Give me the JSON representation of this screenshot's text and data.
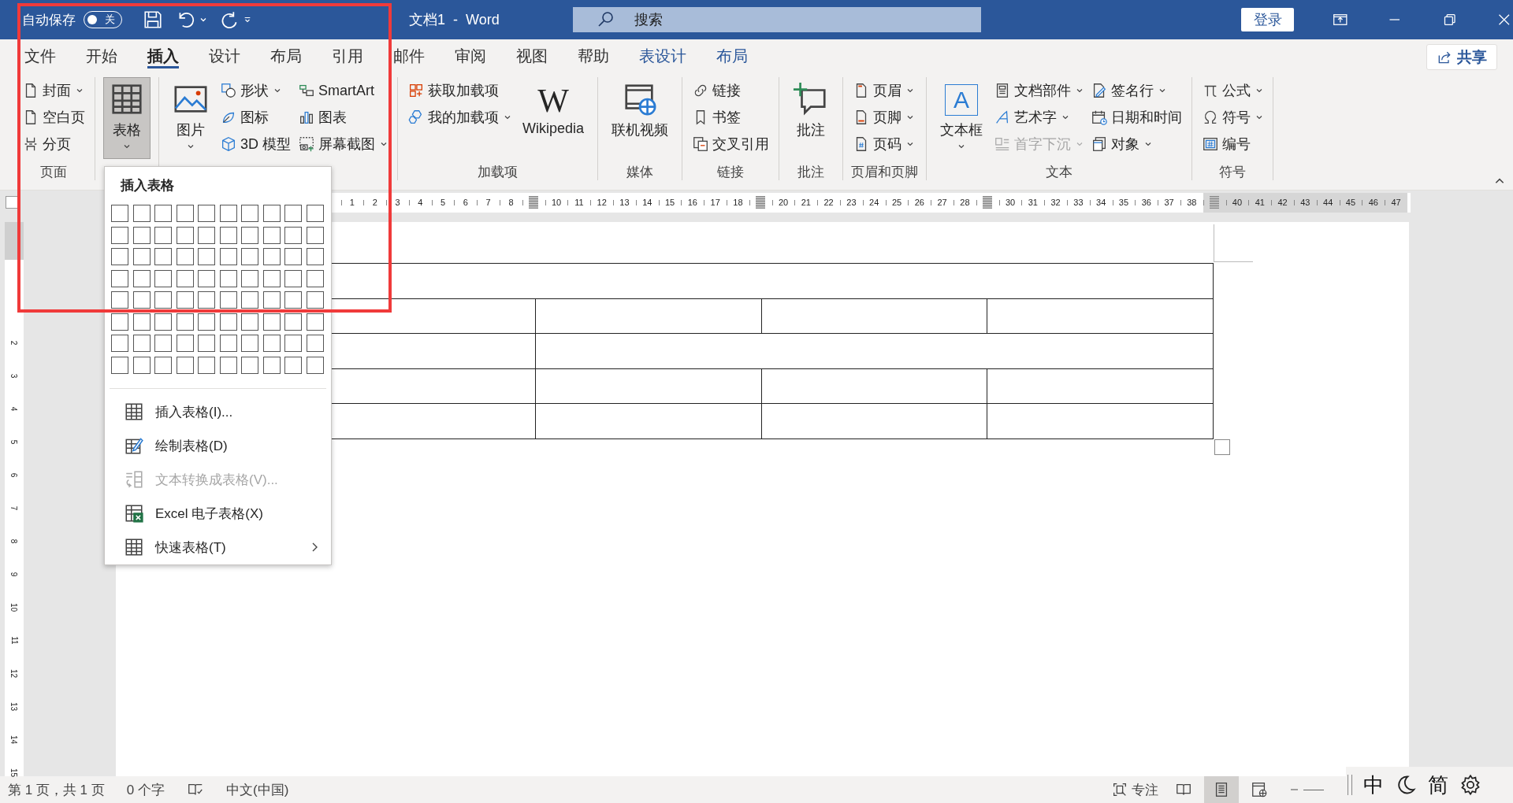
{
  "title_bar": {
    "autosave_label": "自动保存",
    "autosave_toggle": {
      "on": false,
      "label": "关"
    },
    "title": "文档1  -  Word",
    "search": {
      "placeholder": "搜索"
    },
    "sign_in": "登录"
  },
  "tabs": [
    {
      "label": "文件",
      "selected": false,
      "kind": "standard"
    },
    {
      "label": "开始",
      "selected": false,
      "kind": "standard"
    },
    {
      "label": "插入",
      "selected": true,
      "kind": "standard"
    },
    {
      "label": "设计",
      "selected": false,
      "kind": "standard"
    },
    {
      "label": "布局",
      "selected": false,
      "kind": "standard"
    },
    {
      "label": "引用",
      "selected": false,
      "kind": "standard"
    },
    {
      "label": "邮件",
      "selected": false,
      "kind": "standard"
    },
    {
      "label": "审阅",
      "selected": false,
      "kind": "standard"
    },
    {
      "label": "视图",
      "selected": false,
      "kind": "standard"
    },
    {
      "label": "帮助",
      "selected": false,
      "kind": "standard"
    },
    {
      "label": "表设计",
      "selected": false,
      "kind": "contextual"
    },
    {
      "label": "布局",
      "selected": false,
      "kind": "contextual"
    }
  ],
  "share_button": "共享",
  "ribbon": {
    "groups": [
      {
        "label": "页面",
        "columns": [
          {
            "kind": "stack",
            "items": [
              {
                "label": "封面",
                "dropdown": true
              },
              {
                "label": "空白页",
                "dropdown": false
              },
              {
                "label": "分页",
                "dropdown": false
              }
            ]
          }
        ]
      },
      {
        "columns": [
          {
            "kind": "large",
            "items": [
              {
                "label": "表格",
                "dropdown": true,
                "pressed": true
              }
            ]
          }
        ]
      },
      {
        "columns": [
          {
            "kind": "large",
            "items": [
              {
                "label": "图片",
                "dropdown": true,
                "pressed": false
              }
            ]
          },
          {
            "kind": "stack",
            "items": [
              {
                "label": "形状",
                "dropdown": true
              },
              {
                "label": "图标",
                "dropdown": false
              },
              {
                "label": "3D 模型",
                "dropdown": false
              }
            ]
          },
          {
            "kind": "stack",
            "items": [
              {
                "label": "SmartArt",
                "dropdown": false
              },
              {
                "label": "图表",
                "dropdown": false
              },
              {
                "label": "屏幕截图",
                "dropdown": true
              }
            ]
          }
        ]
      },
      {
        "label": "加载项",
        "columns": [
          {
            "kind": "stack",
            "items": [
              {
                "label": "获取加载项",
                "dropdown": false
              },
              {
                "label": "我的加载项",
                "dropdown": true
              }
            ]
          },
          {
            "kind": "large",
            "items": [
              {
                "label": "Wikipedia",
                "glyph": "W",
                "dropdown": false,
                "pressed": false
              }
            ]
          }
        ]
      },
      {
        "label": "媒体",
        "columns": [
          {
            "kind": "large",
            "items": [
              {
                "label": "联机视频",
                "dropdown": false,
                "pressed": false
              }
            ]
          }
        ]
      },
      {
        "label": "链接",
        "columns": [
          {
            "kind": "stack",
            "items": [
              {
                "label": "链接",
                "dropdown": false
              },
              {
                "label": "书签",
                "dropdown": false
              },
              {
                "label": "交叉引用",
                "dropdown": false
              }
            ]
          }
        ]
      },
      {
        "label": "批注",
        "columns": [
          {
            "kind": "large",
            "items": [
              {
                "label": "批注",
                "dropdown": false,
                "pressed": false
              }
            ]
          }
        ]
      },
      {
        "label": "页眉和页脚",
        "columns": [
          {
            "kind": "stack",
            "items": [
              {
                "label": "页眉",
                "dropdown": true
              },
              {
                "label": "页脚",
                "dropdown": true
              },
              {
                "label": "页码",
                "dropdown": true
              }
            ]
          }
        ]
      },
      {
        "label": "文本",
        "columns": [
          {
            "kind": "large",
            "items": [
              {
                "label": "文本框",
                "glyph": "A",
                "dropdown": true,
                "pressed": false
              }
            ]
          },
          {
            "kind": "stack",
            "items": [
              {
                "label": "文档部件",
                "dropdown": true,
                "disabled": false
              },
              {
                "label": "艺术字",
                "dropdown": true,
                "disabled": false
              },
              {
                "label": "首字下沉",
                "dropdown": true,
                "disabled": true
              }
            ]
          },
          {
            "kind": "stack",
            "items": [
              {
                "label": "签名行",
                "dropdown": true
              },
              {
                "label": "日期和时间",
                "dropdown": false
              },
              {
                "label": "对象",
                "dropdown": true
              }
            ]
          }
        ]
      },
      {
        "label": "符号",
        "columns": [
          {
            "kind": "stack",
            "items": [
              {
                "label": "公式",
                "dropdown": true
              },
              {
                "label": "符号",
                "dropdown": true
              },
              {
                "label": "编号",
                "dropdown": false
              }
            ]
          }
        ]
      }
    ]
  },
  "horizontal_ruler": [
    {
      "kind": "number",
      "label": "1"
    },
    {
      "kind": "number",
      "label": "2"
    },
    {
      "kind": "number",
      "label": "3"
    },
    {
      "kind": "number",
      "label": "4"
    },
    {
      "kind": "number",
      "label": "5"
    },
    {
      "kind": "number",
      "label": "6"
    },
    {
      "kind": "number",
      "label": "7"
    },
    {
      "kind": "number",
      "label": "8"
    },
    {
      "kind": "marker"
    },
    {
      "kind": "number",
      "label": "10"
    },
    {
      "kind": "number",
      "label": "11"
    },
    {
      "kind": "number",
      "label": "12"
    },
    {
      "kind": "number",
      "label": "13"
    },
    {
      "kind": "number",
      "label": "14"
    },
    {
      "kind": "number",
      "label": "15"
    },
    {
      "kind": "number",
      "label": "16"
    },
    {
      "kind": "number",
      "label": "17"
    },
    {
      "kind": "number",
      "label": "18"
    },
    {
      "kind": "marker"
    },
    {
      "kind": "number",
      "label": "20"
    },
    {
      "kind": "number",
      "label": "21"
    },
    {
      "kind": "number",
      "label": "22"
    },
    {
      "kind": "number",
      "label": "23"
    },
    {
      "kind": "number",
      "label": "24"
    },
    {
      "kind": "number",
      "label": "25"
    },
    {
      "kind": "number",
      "label": "26"
    },
    {
      "kind": "number",
      "label": "27"
    },
    {
      "kind": "number",
      "label": "28"
    },
    {
      "kind": "marker"
    },
    {
      "kind": "number",
      "label": "30"
    },
    {
      "kind": "number",
      "label": "31"
    },
    {
      "kind": "number",
      "label": "32"
    },
    {
      "kind": "number",
      "label": "33"
    },
    {
      "kind": "number",
      "label": "34"
    },
    {
      "kind": "number",
      "label": "35"
    },
    {
      "kind": "number",
      "label": "36"
    },
    {
      "kind": "number",
      "label": "37"
    },
    {
      "kind": "number",
      "label": "38"
    },
    {
      "kind": "marker"
    },
    {
      "kind": "number",
      "label": "40"
    },
    {
      "kind": "number",
      "label": "41"
    },
    {
      "kind": "number",
      "label": "42"
    },
    {
      "kind": "number",
      "label": "43"
    },
    {
      "kind": "number",
      "label": "44"
    },
    {
      "kind": "number",
      "label": "45"
    },
    {
      "kind": "number",
      "label": "46"
    },
    {
      "kind": "number",
      "label": "47"
    }
  ],
  "vertical_ruler": [
    "2",
    "3",
    "4",
    "5",
    "6",
    "7",
    "8",
    "9",
    "10",
    "11",
    "12",
    "13",
    "14",
    "15"
  ],
  "insert_table_menu": {
    "title": "插入表格",
    "items": [
      {
        "label": "插入表格(I)...",
        "kind": "command",
        "disabled": false
      },
      {
        "label": "绘制表格(D)",
        "kind": "command",
        "disabled": false
      },
      {
        "label": "文本转换成表格(V)...",
        "kind": "command",
        "disabled": true
      },
      {
        "label": "Excel 电子表格(X)",
        "kind": "command",
        "disabled": false
      },
      {
        "label": "快速表格(T)",
        "kind": "submenu",
        "disabled": false
      }
    ]
  },
  "status_bar": {
    "page": "第 1 页，共 1 页",
    "words": "0 个字",
    "language": "中文(中国)",
    "focus": "专注",
    "views": [
      {
        "selected": false
      },
      {
        "selected": true
      },
      {
        "selected": false
      }
    ]
  },
  "ime_bar": {
    "mode": "中",
    "script": "简"
  }
}
